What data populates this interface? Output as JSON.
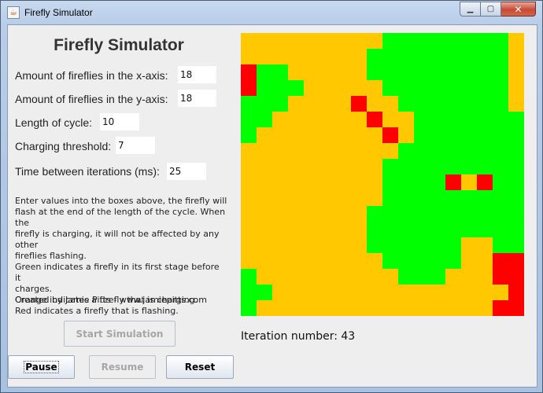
{
  "window": {
    "title": "Firefly Simulator",
    "controls": {
      "minimize": "▁",
      "maximize": "▢",
      "close": "✕"
    }
  },
  "panel": {
    "heading": "Firefly Simulator",
    "fields": {
      "x_label": "Amount of fireflies in the x-axis:",
      "x_value": "18",
      "y_label": "Amount of fireflies in the y-axis:",
      "y_value": "18",
      "cycle_label": "Length of cycle:",
      "cycle_value": "10",
      "threshold_label": "Charging threshold:",
      "threshold_value": "7",
      "time_label": "Time between iterations (ms):",
      "time_value": "25"
    },
    "description": [
      "Enter values into the boxes above, the firefly will",
      "flash at the end of the length of the cycle. When the",
      "firefly is charging, it will not be affected by any other",
      "fireflies flashing.",
      "Green indicates a firefly in its first stage before it",
      "charges.",
      "Orange indicates a firefly that is charging.",
      "Red indicates a firefly that is flashing."
    ],
    "credit": "Created by Jamie Pitts - www.jamiepitts.com"
  },
  "buttons": {
    "start": "Start Simulation",
    "pause": "Pause",
    "resume": "Resume",
    "reset": "Reset"
  },
  "status": {
    "iteration_label": "Iteration number: 43"
  },
  "colors": {
    "green": "#00ff00",
    "orange": "#ffc800",
    "red": "#ff0000"
  },
  "grid": {
    "rows": 18,
    "cols": 18,
    "legend": {
      "G": "green",
      "O": "orange",
      "R": "red"
    },
    "cells": [
      "OOOOOOOOOGGGGGGGGO",
      "OOOOOOOOGGGGGGGGGO",
      "RGGOOOOOGGGGGGGGGO",
      "RGGGOOOOOGGGGGGGGO",
      "GGGOOOOROOGGGGGGGO",
      "GGOOOOOOROOGGGGGGG",
      "GOOOOOOOOROGGGGGGG",
      "OOOOOOOOOOGGGGGGGG",
      "OOOOOOOOOGGGGGGGGG",
      "OOOOOOOOOGGGGRORGG",
      "OOOOOOOOOGGGGGGGGG",
      "OOOOOOOOGGGGGGGGGG",
      "OOOOOOOOGGGGGGGGGG",
      "OOOOOOOOGGGGGGOOGG",
      "OOOOOOOOOGGGGGOORR",
      "GOOOOOOOOOGGGOOORR",
      "GGOOOOOOOOOOOOOOOR",
      "GOOOOOOOOOOOOOOORR"
    ]
  }
}
